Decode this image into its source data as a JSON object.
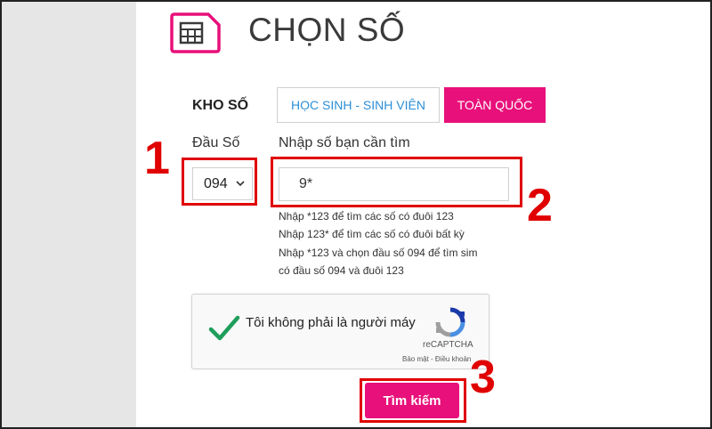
{
  "header": {
    "title": "CHỌN SỐ",
    "icon": "sim-card-icon",
    "accent_color": "#e8107a"
  },
  "category": {
    "label": "KHO SỐ",
    "tabs": [
      {
        "label": "HỌC SINH - SINH VIÊN",
        "active": false
      },
      {
        "label": "TOÀN QUỐC",
        "active": true
      }
    ]
  },
  "prefix": {
    "label": "Đầu Số",
    "value": "094"
  },
  "search": {
    "label": "Nhập số bạn cần tìm",
    "value": "9*",
    "hints": [
      "Nhập *123 để tìm các số có đuôi 123",
      "Nhập 123* để tìm các số có đuôi bất kỳ",
      "Nhập *123 và chọn đầu số 094 để tìm sim",
      "có đầu số 094 và đuôi 123"
    ]
  },
  "captcha": {
    "text": "Tôi không phải là người máy",
    "brand": "reCAPTCHA",
    "links": "Bảo mật - Điều khoản",
    "checked": true
  },
  "submit": {
    "label": "Tìm kiếm"
  },
  "annotations": {
    "step1": "1",
    "step2": "2",
    "step3": "3",
    "color": "#e00000"
  }
}
